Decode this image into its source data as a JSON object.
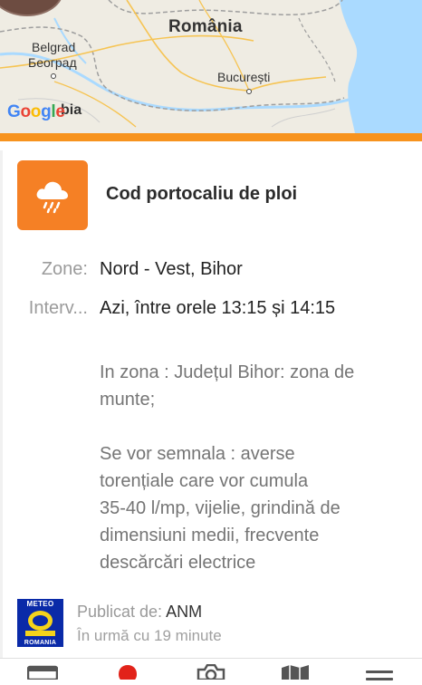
{
  "map": {
    "country_label": "România",
    "cities": [
      {
        "id": "belgrad",
        "label": "Belgrad"
      },
      {
        "id": "beograd",
        "label": "Београд"
      },
      {
        "id": "bucuresti",
        "label": "București"
      },
      {
        "id": "serbia",
        "label": "bia"
      }
    ],
    "attribution": "Google",
    "colors": {
      "land": "#efece3",
      "sea": "#aadaff",
      "border": "#9e9e9e",
      "road": "#f6c453"
    }
  },
  "alert": {
    "accent_color": "#f58025",
    "icon": "rain-cloud-icon",
    "title": "Cod portocaliu de ploi",
    "fields": [
      {
        "label": "Zone:",
        "value": "Nord - Vest, Bihor"
      },
      {
        "label": "Interv...",
        "value": "Azi, între orele 13:15 și 14:15"
      }
    ],
    "zone_lines": [
      "In zona : Județul Bihor: zona de",
      "munte;"
    ],
    "details_lines": [
      "Se vor semnala : averse",
      "torențiale care vor cumula",
      "35-40 l/mp, vijelie, grindină de",
      "dimensiuni medii, frecvente",
      "descărcări electrice"
    ]
  },
  "publisher": {
    "logo_top": "METEO",
    "logo_bottom": "ROMANIA",
    "prefix": "Publicat de:",
    "name": "ANM",
    "time_ago": "În urmă cu 19 minute"
  },
  "bottom_nav": [
    {
      "icon": "news-icon"
    },
    {
      "icon": "location-pin-icon"
    },
    {
      "icon": "camera-icon"
    },
    {
      "icon": "map-icon"
    },
    {
      "icon": "menu-icon"
    }
  ]
}
